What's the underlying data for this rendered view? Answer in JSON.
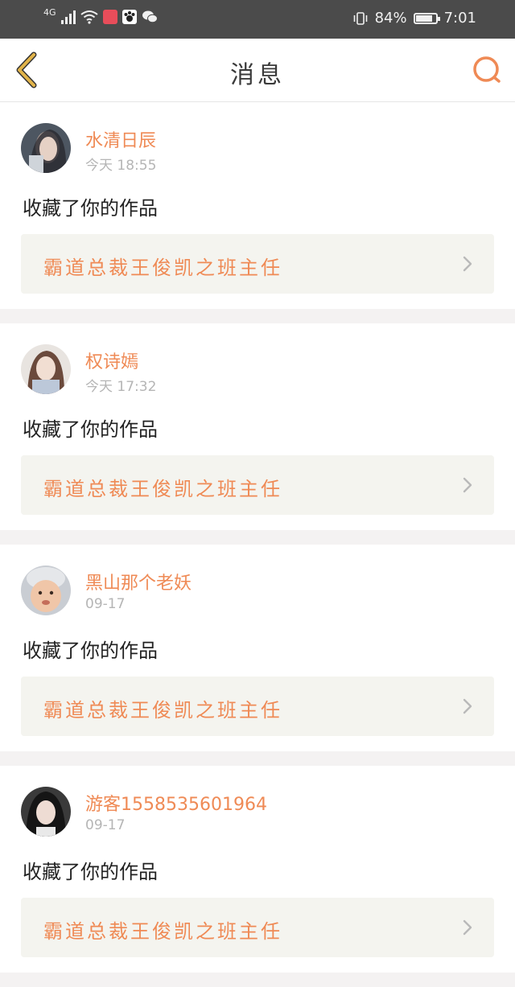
{
  "status_bar": {
    "network": "4G",
    "battery_percent": "84%",
    "battery_level": 0.84,
    "time": "7:01",
    "icons": [
      "signal-icon",
      "wifi-icon",
      "book-app-icon",
      "paw-app-icon",
      "wechat-icon",
      "vibrate-icon",
      "battery-icon"
    ]
  },
  "header": {
    "title": "消息",
    "back_icon": "chevron-left-icon",
    "search_icon": "search-icon"
  },
  "colors": {
    "accent": "#ef8a55",
    "back_icon": "#e2b44a",
    "text": "#222222",
    "muted": "#b5b5b5",
    "box_bg": "#f4f4ef"
  },
  "messages": [
    {
      "username": "水清日辰",
      "time": "今天 18:55",
      "action": "收藏了你的作品",
      "work_title": "霸道总裁王俊凯之班主任"
    },
    {
      "username": "权诗嫣",
      "time": "今天 17:32",
      "action": "收藏了你的作品",
      "work_title": "霸道总裁王俊凯之班主任"
    },
    {
      "username": "黑山那个老妖",
      "time": "09-17",
      "action": "收藏了你的作品",
      "work_title": "霸道总裁王俊凯之班主任"
    },
    {
      "username": "游客1558535601964",
      "time": "09-17",
      "action": "收藏了你的作品",
      "work_title": "霸道总裁王俊凯之班主任"
    }
  ]
}
